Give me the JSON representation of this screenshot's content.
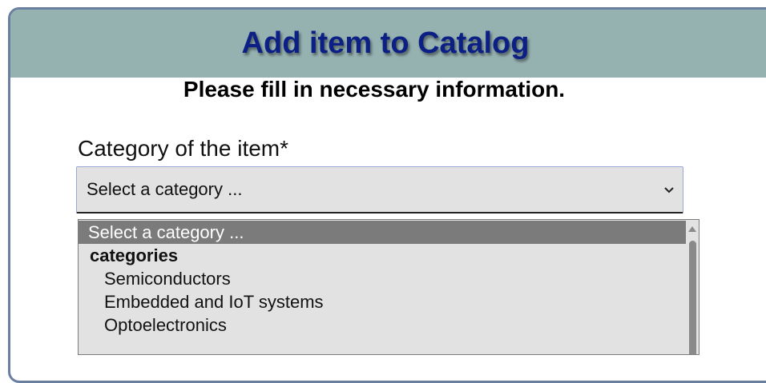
{
  "header": {
    "title": "Add item to Catalog"
  },
  "form": {
    "subtitle": "Please fill in necessary information.",
    "category_label": "Category of the item*",
    "category_select": {
      "selected": "Select a category ...",
      "options": [
        {
          "label": "Select a category ...",
          "kind": "placeholder",
          "highlighted": true
        },
        {
          "label": "categories",
          "kind": "group"
        },
        {
          "label": "Semiconductors",
          "kind": "option"
        },
        {
          "label": "Embedded and IoT systems",
          "kind": "option"
        },
        {
          "label": "Optoelectronics",
          "kind": "option"
        }
      ]
    }
  },
  "colors": {
    "header_bg": "#95b1b0",
    "title": "#0b1f84",
    "panel_border": "#6a7fa0",
    "highlight": "#7b7b7b",
    "select_bg": "#e2e2e2"
  },
  "icons": {
    "select_chevron": "chevron-down-icon",
    "scroll_up": "scroll-up-arrow-icon"
  }
}
